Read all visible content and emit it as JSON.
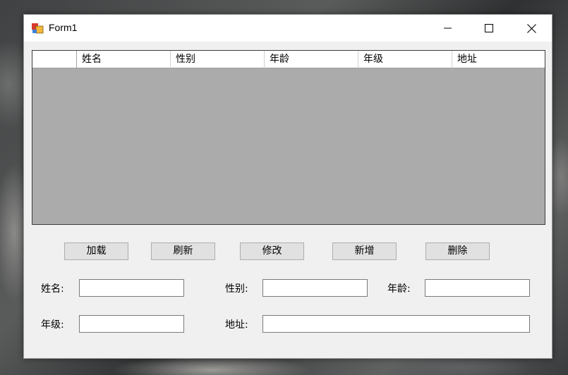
{
  "window": {
    "title": "Form1"
  },
  "grid": {
    "columns": [
      "姓名",
      "性别",
      "年龄",
      "年级",
      "地址"
    ]
  },
  "buttons": {
    "load": "加载",
    "refresh": "刷新",
    "modify": "修改",
    "add": "新增",
    "delete": "删除"
  },
  "form": {
    "name_label": "姓名:",
    "gender_label": "性别:",
    "age_label": "年龄:",
    "grade_label": "年级:",
    "address_label": "地址:",
    "name_value": "",
    "gender_value": "",
    "age_value": "",
    "grade_value": "",
    "address_value": ""
  }
}
